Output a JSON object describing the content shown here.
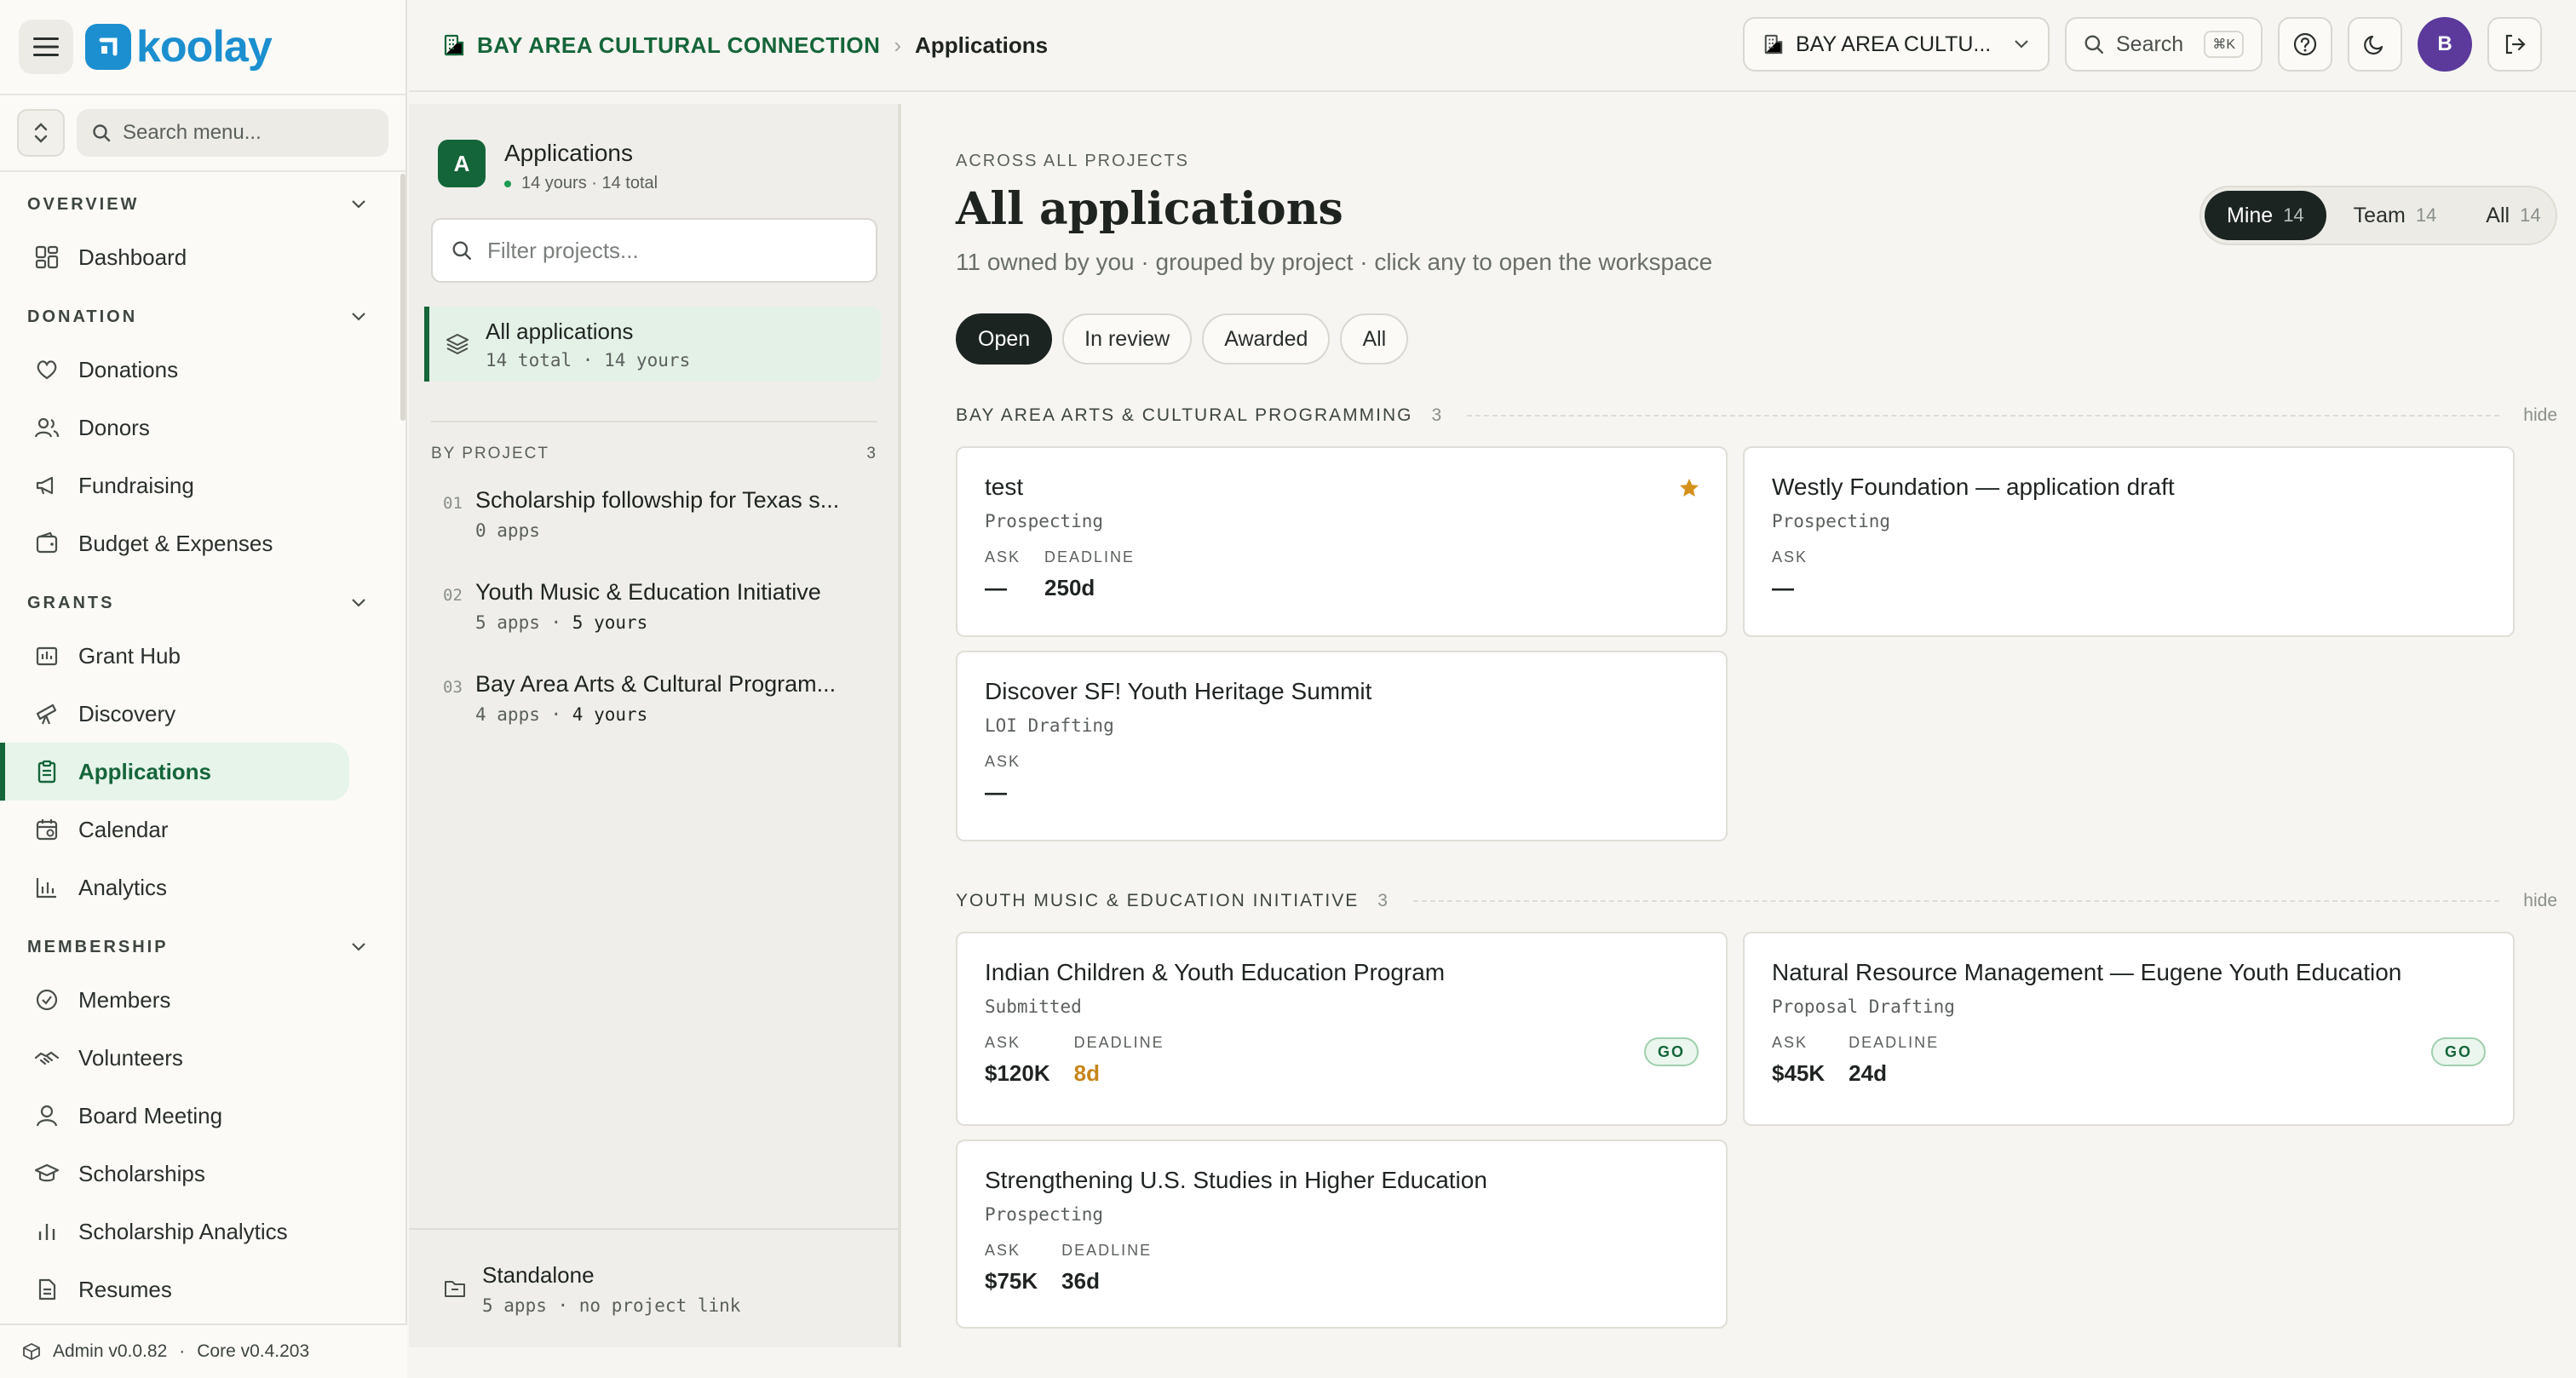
{
  "brand": {
    "name": "koolay",
    "color": "#1b8fcf"
  },
  "menu_search": {
    "placeholder": "Search menu..."
  },
  "sidebar": {
    "sections": [
      {
        "label": "OVERVIEW",
        "items": [
          {
            "label": "Dashboard",
            "icon": "dashboard-icon"
          }
        ]
      },
      {
        "label": "DONATION",
        "items": [
          {
            "label": "Donations",
            "icon": "heart-hand-icon"
          },
          {
            "label": "Donors",
            "icon": "users-icon"
          },
          {
            "label": "Fundraising",
            "icon": "megaphone-icon"
          },
          {
            "label": "Budget & Expenses",
            "icon": "wallet-icon"
          }
        ]
      },
      {
        "label": "GRANTS",
        "items": [
          {
            "label": "Grant Hub",
            "icon": "grant-hub-icon"
          },
          {
            "label": "Discovery",
            "icon": "telescope-icon"
          },
          {
            "label": "Applications",
            "icon": "clipboard-icon",
            "active": true
          },
          {
            "label": "Calendar",
            "icon": "calendar-icon"
          },
          {
            "label": "Analytics",
            "icon": "bar-chart-icon"
          }
        ]
      },
      {
        "label": "MEMBERSHIP",
        "items": [
          {
            "label": "Members",
            "icon": "check-circle-icon"
          },
          {
            "label": "Volunteers",
            "icon": "handshake-icon"
          },
          {
            "label": "Board Meeting",
            "icon": "user-icon"
          },
          {
            "label": "Scholarships",
            "icon": "graduation-cap-icon"
          },
          {
            "label": "Scholarship Analytics",
            "icon": "bar-chart-icon"
          },
          {
            "label": "Resumes",
            "icon": "document-icon"
          }
        ]
      }
    ],
    "footer": {
      "admin": "Admin v0.0.82",
      "sep": "·",
      "core": "Core v0.4.203"
    }
  },
  "header": {
    "org": "BAY AREA CULTURAL CONNECTION",
    "sep": "›",
    "page": "Applications",
    "org_select": "BAY AREA CULTU...",
    "search_label": "Search",
    "search_kbd": "⌘K",
    "avatar": "B"
  },
  "projects_panel": {
    "badge": "A",
    "title": "Applications",
    "subtitle": "14 yours · 14 total",
    "filter_placeholder": "Filter projects...",
    "all_apps": {
      "title": "All applications",
      "sub": "14 total · 14 yours"
    },
    "by_project": {
      "label": "BY PROJECT",
      "count": "3"
    },
    "projects": [
      {
        "num": "01",
        "name": "Scholarship followship for Texas s...",
        "apps": "0 apps",
        "yours": ""
      },
      {
        "num": "02",
        "name": "Youth Music & Education Initiative",
        "apps": "5 apps",
        "yours": "5 yours"
      },
      {
        "num": "03",
        "name": "Bay Area Arts & Cultural Program...",
        "apps": "4 apps",
        "yours": "4 yours"
      }
    ],
    "standalone": {
      "title": "Standalone",
      "sub": "5 apps · no project link"
    }
  },
  "main": {
    "eyebrow": "ACROSS ALL PROJECTS",
    "title": "All applications",
    "subtitle": "11 owned by you · grouped by project · click any to open the workspace",
    "scope": [
      {
        "label": "Mine",
        "count": "14",
        "active": true
      },
      {
        "label": "Team",
        "count": "14"
      },
      {
        "label": "All",
        "count": "14"
      }
    ],
    "status_filters": [
      {
        "label": "Open",
        "active": true
      },
      {
        "label": "In review"
      },
      {
        "label": "Awarded"
      },
      {
        "label": "All"
      }
    ],
    "groups": [
      {
        "name": "BAY AREA ARTS & CULTURAL PROGRAMMING",
        "count": "3",
        "hide": "hide",
        "cards": [
          {
            "title": "test",
            "status": "Prospecting",
            "ask_label": "ASK",
            "ask": "—",
            "deadline_label": "DEADLINE",
            "deadline": "250d",
            "starred": true
          },
          {
            "title": "Westly Foundation — application draft",
            "status": "Prospecting",
            "ask_label": "ASK",
            "ask": "—"
          },
          {
            "title": "Discover SF! Youth Heritage Summit",
            "status": "LOI Drafting",
            "ask_label": "ASK",
            "ask": "—"
          }
        ]
      },
      {
        "name": "YOUTH MUSIC & EDUCATION INITIATIVE",
        "count": "3",
        "hide": "hide",
        "cards": [
          {
            "title": "Indian Children & Youth Education Program",
            "status": "Submitted",
            "ask_label": "ASK",
            "ask": "$120K",
            "deadline_label": "DEADLINE",
            "deadline": "8d",
            "deadline_warn": true,
            "badge": "GO"
          },
          {
            "title": "Natural Resource Management — Eugene Youth Education",
            "status": "Proposal Drafting",
            "ask_label": "ASK",
            "ask": "$45K",
            "deadline_label": "DEADLINE",
            "deadline": "24d",
            "badge": "GO"
          },
          {
            "title": "Strengthening U.S. Studies in Higher Education",
            "status": "Prospecting",
            "ask_label": "ASK",
            "ask": "$75K",
            "deadline_label": "DEADLINE",
            "deadline": "36d"
          }
        ]
      }
    ]
  }
}
